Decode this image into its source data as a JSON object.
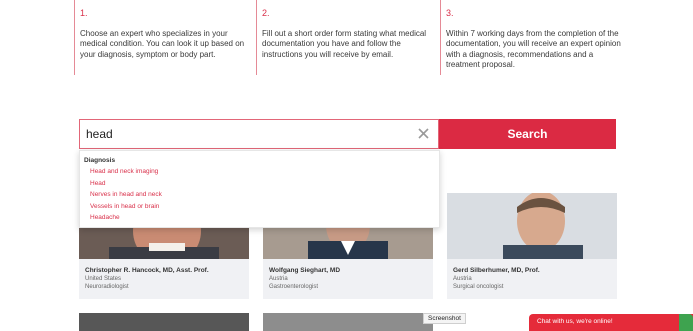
{
  "steps": [
    {
      "number": "1.",
      "text": "Choose an expert who specializes in your medical condition. You can look it up based on your diagnosis, symptom or body part."
    },
    {
      "number": "2.",
      "text": "Fill out a short order form stating what medical documentation you have and follow the instructions you will receive by email."
    },
    {
      "number": "3.",
      "text": "Within 7 working days from the completion of the documentation, you will receive an expert opinion with a diagnosis, recommendations and a treatment proposal."
    }
  ],
  "search": {
    "value": "head",
    "button_label": "Search",
    "clear_icon": "close-icon"
  },
  "dropdown": {
    "header": "Diagnosis",
    "items": [
      "Head and neck imaging",
      "Head",
      "Nerves in head and neck",
      "Vessels in head or brain",
      "Headache"
    ]
  },
  "experts": [
    {
      "name": "Christopher R. Hancock, MD, Asst. Prof.",
      "country": "United States",
      "specialty": "Neuroradiologist"
    },
    {
      "name": "Wolfgang Sieghart, MD",
      "country": "Austria",
      "specialty": "Gastroenterologist"
    },
    {
      "name": "Gerd Silberhumer, MD, Prof.",
      "country": "Austria",
      "specialty": "Surgical oncologist"
    }
  ],
  "tooltip": "Screenshot",
  "chat": {
    "label": "Chat with us, we're online!"
  },
  "colors": {
    "accent": "#db2a43",
    "link": "#d9304a",
    "chat": "#e52b3a",
    "chat_accent": "#3ea34f"
  }
}
